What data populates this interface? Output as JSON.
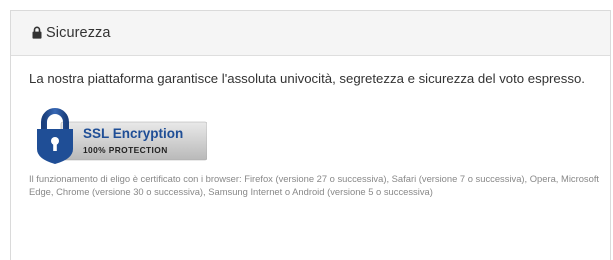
{
  "panel": {
    "title": "Sicurezza",
    "title_icon": "lock-icon",
    "intro": "La nostra piattaforma garantisce l'assoluta univocità, segretezza e sicurezza del voto espresso.",
    "badge": {
      "icon": "padlock-icon",
      "line1": "SSL Encryption",
      "line2": "100% PROTECTION",
      "accent": "#1f4e96"
    },
    "browsers_note": "Il funzionamento di eligo è certificato con i browser: Firefox (versione 27 o successiva), Safari (versione 7 o successiva), Opera, Microsoft Edge, Chrome (versione 30 o successiva), Samsung Internet o Android (versione 5 o successiva)"
  },
  "colors": {
    "heading_bg": "#f5f5f5",
    "border": "#dadada",
    "text": "#333333",
    "muted_text": "#888888",
    "badge_blue": "#1f4e96"
  }
}
